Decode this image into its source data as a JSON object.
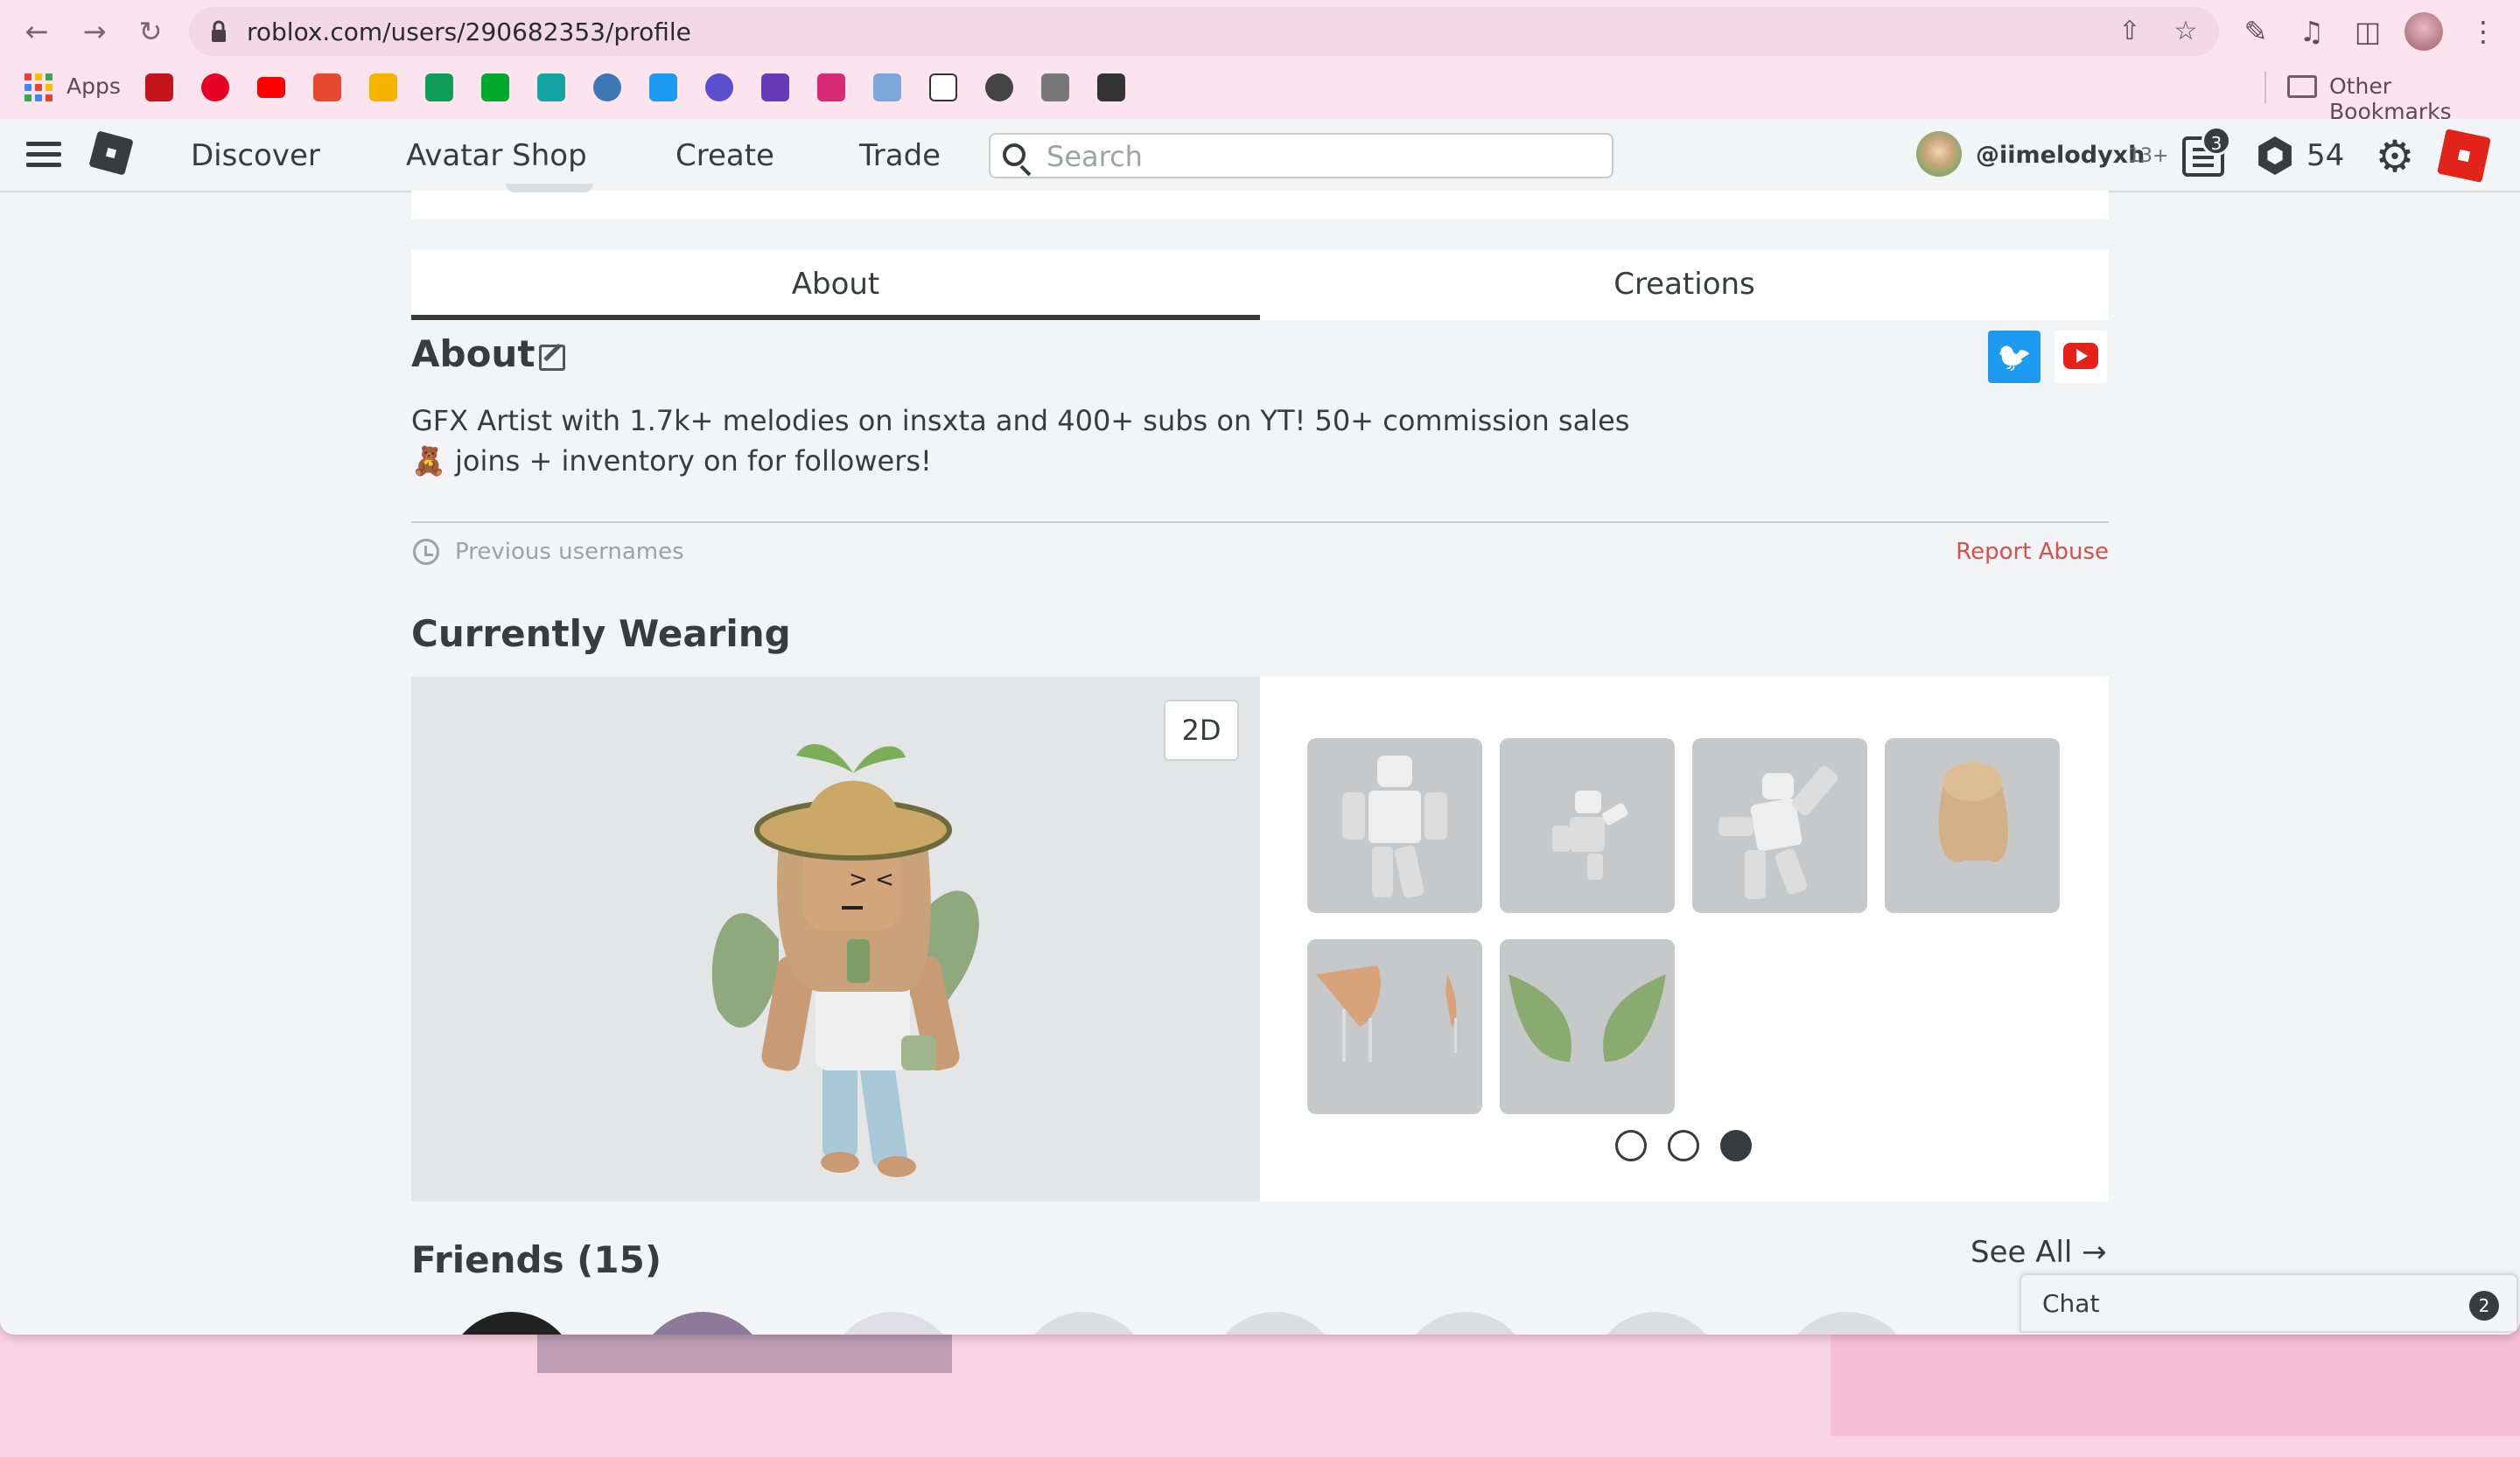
{
  "browser": {
    "url": "roblox.com/users/290682353/profile",
    "apps_label": "Apps",
    "other_bookmarks": "Other Bookmarks",
    "bookmark_icons": [
      "netflix-icon",
      "pinterest-icon",
      "youtube-icon",
      "m-icon",
      "w-icon",
      "classroom-icon",
      "evernote-icon",
      "e-icon",
      "cloud-icon",
      "twitter-icon",
      "calendar-12-icon",
      "list-icon",
      "instagram-icon",
      "eyes-icon",
      "v-icon",
      "pen-icon",
      "brush-icon",
      "contact-icon"
    ]
  },
  "nav": {
    "links": [
      "Discover",
      "Avatar Shop",
      "Create",
      "Trade"
    ],
    "search_placeholder": "Search",
    "username": "@iimelodyxh",
    "age": "13+",
    "notifications": "3",
    "robux": "54"
  },
  "tabs": {
    "about": "About",
    "creations": "Creations",
    "active": "about"
  },
  "about": {
    "title": "About",
    "bio_line1": "GFX Artist with 1.7k+ melodies on insxta and 400+ subs on YT! 50+ commission sales",
    "bio_line2": "🧸 joins + inventory on for followers!",
    "previous_usernames": "Previous usernames",
    "report_abuse": "Report Abuse",
    "social": [
      "twitter-icon",
      "youtube-icon"
    ]
  },
  "wearing": {
    "title": "Currently Wearing",
    "toggle_label": "2D",
    "items": [
      "animation-pose",
      "animation-pose",
      "animation-pose",
      "hair",
      "ears",
      "wings"
    ],
    "pages": 3,
    "current_page": 3
  },
  "friends": {
    "title": "Friends (15)",
    "see_all": "See All →"
  },
  "chat": {
    "label": "Chat",
    "count": "2"
  },
  "colors": {
    "browser_pink": "#fce4ee",
    "roblox_bg": "#f2f4f5",
    "text": "#393b3d",
    "report": "#d84f4f",
    "twitter": "#1d9bf0",
    "youtube": "#e62117"
  }
}
